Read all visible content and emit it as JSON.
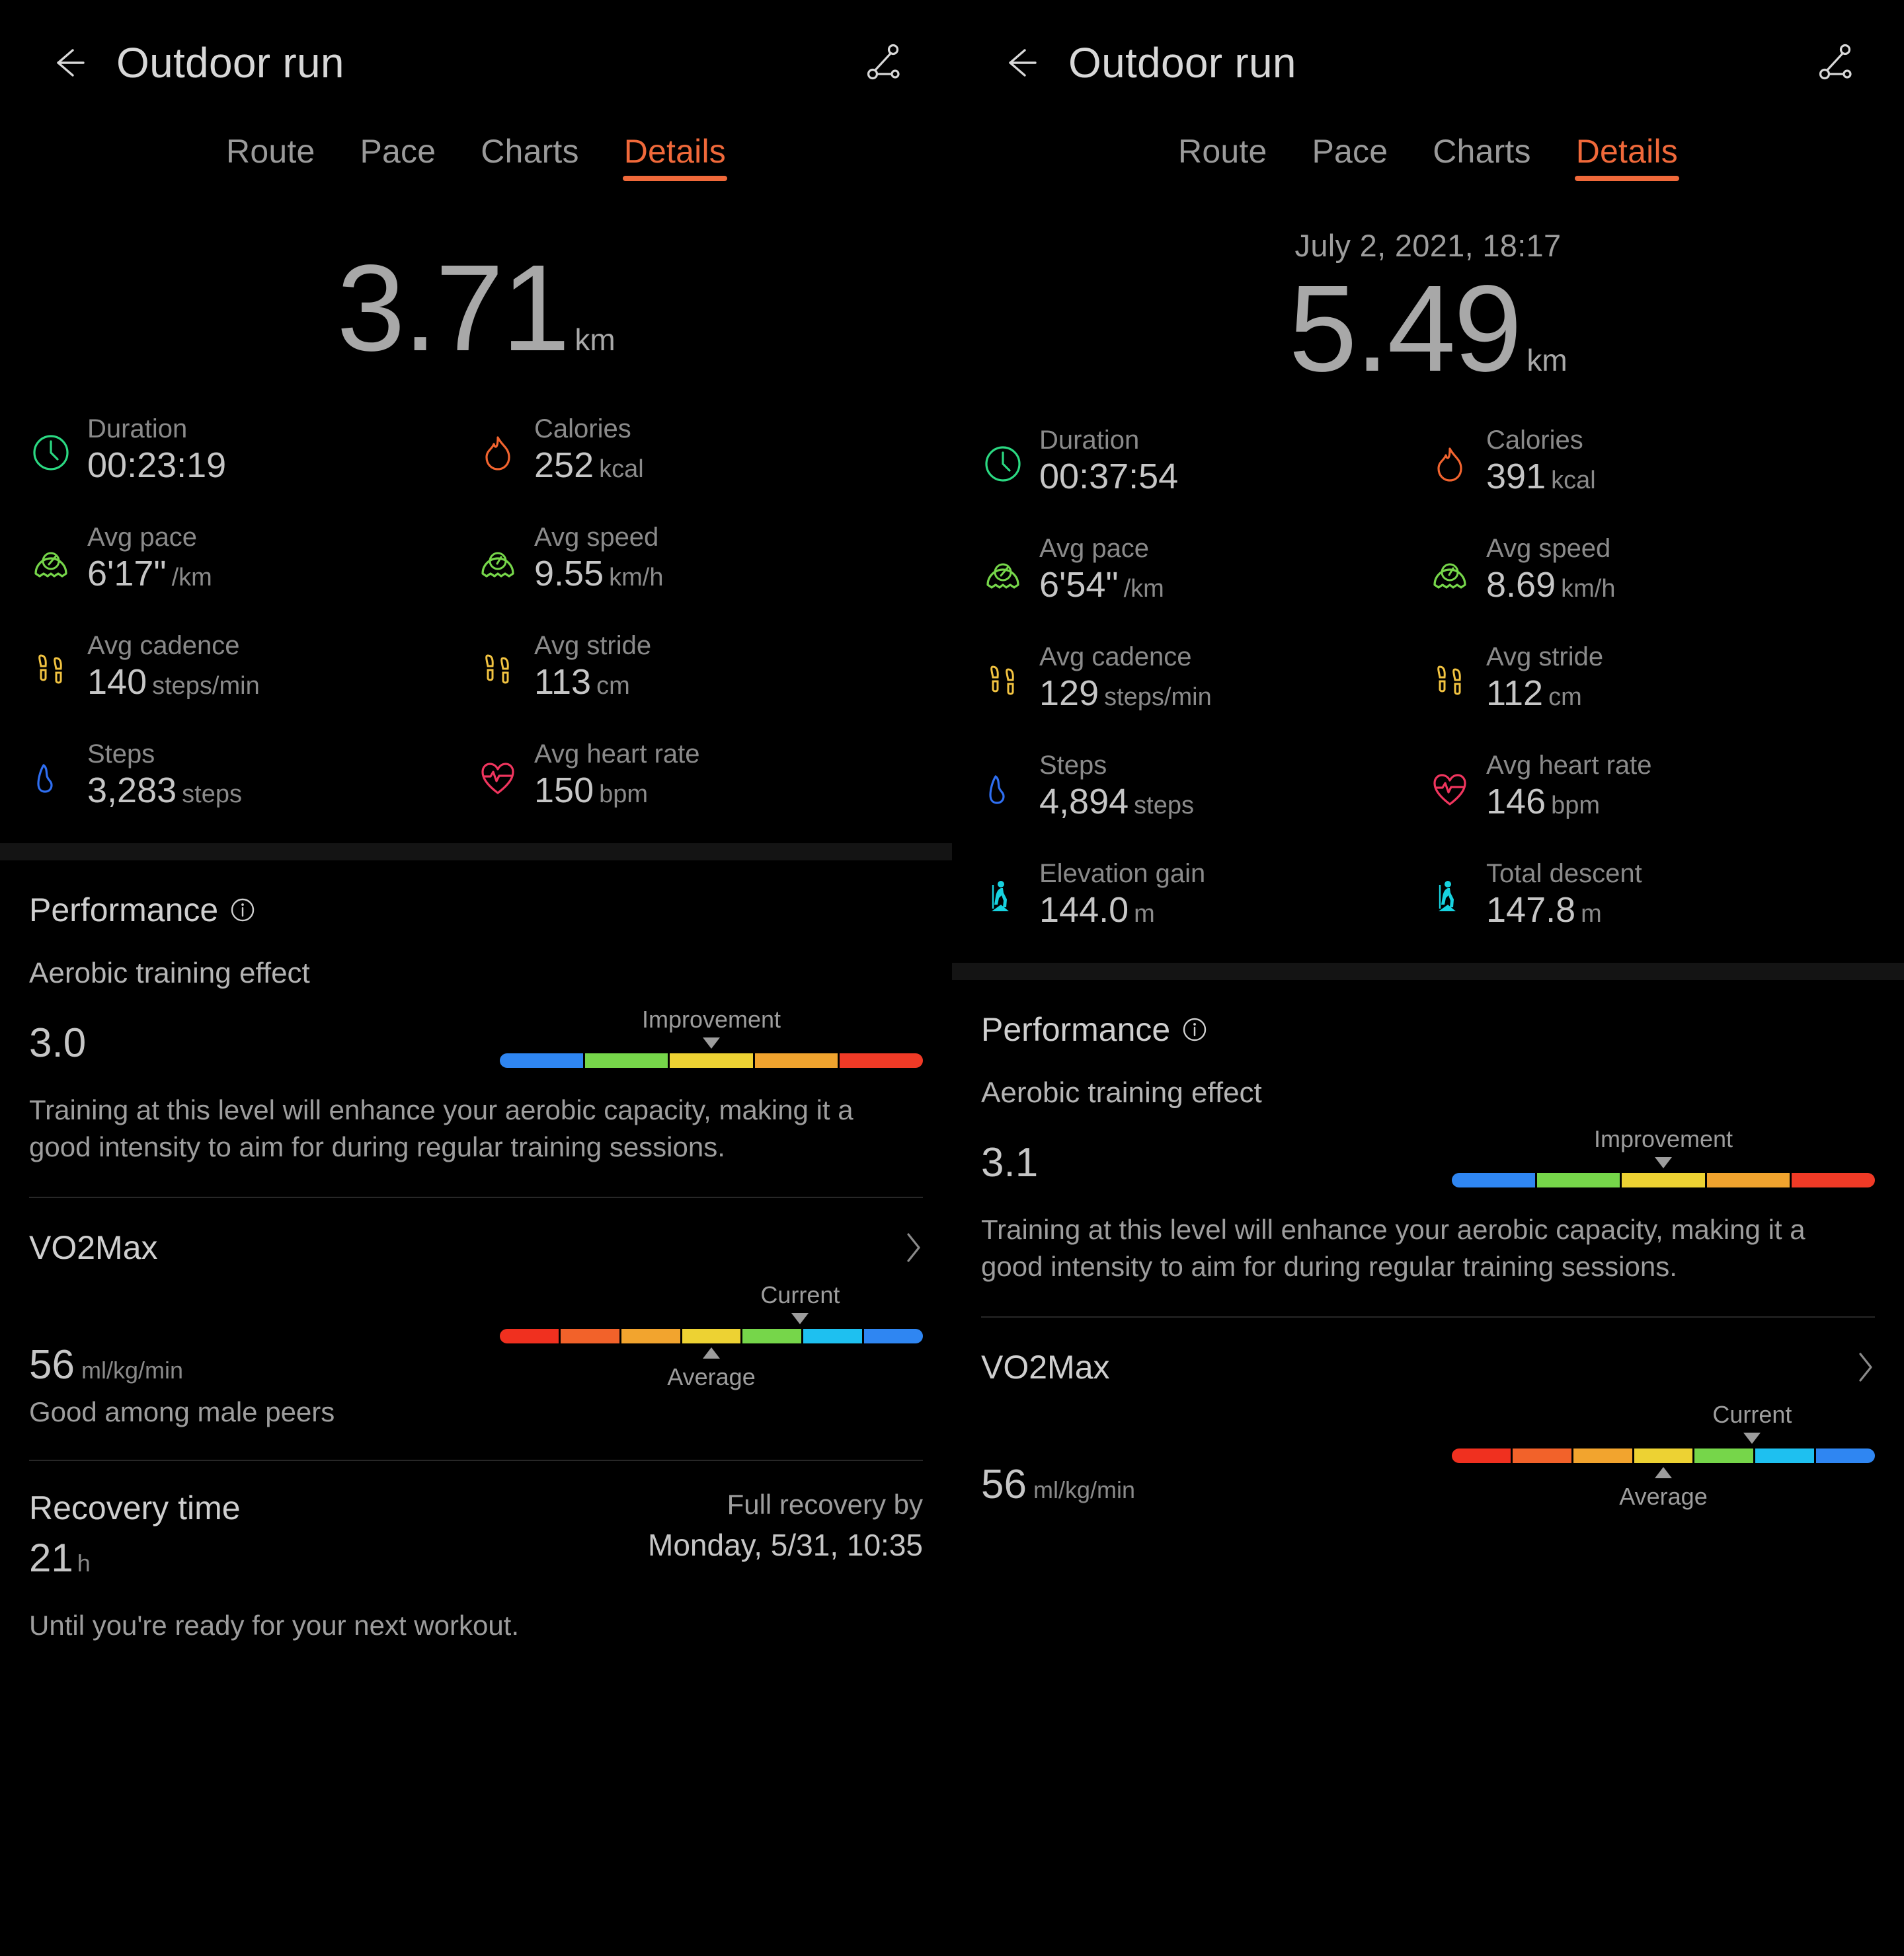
{
  "accent_color": "#f0693a",
  "screens": [
    {
      "appbar": {
        "title": "Outdoor run",
        "back_icon": "arrow-left-icon",
        "share_icon": "share-route-icon"
      },
      "tabs": [
        {
          "label": "Route",
          "active": false
        },
        {
          "label": "Pace",
          "active": false
        },
        {
          "label": "Charts",
          "active": false
        },
        {
          "label": "Details",
          "active": true
        }
      ],
      "session_date": "",
      "hero": {
        "value": "3.71",
        "unit": "km"
      },
      "stats": [
        {
          "icon": "clock-icon",
          "color": "#2bd982",
          "label": "Duration",
          "value": "00:23:19",
          "unit": ""
        },
        {
          "icon": "flame-icon",
          "color": "#f2642f",
          "label": "Calories",
          "value": "252",
          "unit": "kcal"
        },
        {
          "icon": "speedometer-icon",
          "color": "#76d64a",
          "label": "Avg pace",
          "value": "6'17\"",
          "unit": "/km"
        },
        {
          "icon": "speedometer-icon",
          "color": "#76d64a",
          "label": "Avg speed",
          "value": "9.55",
          "unit": "km/h"
        },
        {
          "icon": "footprints-icon",
          "color": "#f2c341",
          "label": "Avg cadence",
          "value": "140",
          "unit": "steps/min"
        },
        {
          "icon": "footprints-icon",
          "color": "#f2c341",
          "label": "Avg stride",
          "value": "113",
          "unit": "cm"
        },
        {
          "icon": "shoe-icon",
          "color": "#2f6ff2",
          "label": "Steps",
          "value": "3,283",
          "unit": "steps"
        },
        {
          "icon": "heart-pulse-icon",
          "color": "#f0355e",
          "label": "Avg heart rate",
          "value": "150",
          "unit": "bpm"
        }
      ],
      "performance": {
        "title": "Performance",
        "info_icon": "info-icon",
        "aerobic": {
          "label": "Aerobic training effect",
          "value": "3.0",
          "marker_label": "Improvement",
          "marker_pos_pct": 50,
          "segments": [
            "#2f86f2",
            "#76d64a",
            "#edd233",
            "#f0a32e",
            "#f03a26"
          ],
          "description": "Training at this level will enhance your aerobic capacity, making it a good intensity to aim for during regular training sessions."
        },
        "vo2max": {
          "label": "VO2Max",
          "value": "56",
          "unit": "ml/kg/min",
          "chevron_icon": "chevron-right-icon",
          "current_label": "Current",
          "current_pos_pct": 71,
          "average_label": "Average",
          "average_pos_pct": 50,
          "segments": [
            "#f0301f",
            "#f2622a",
            "#f2a42e",
            "#edd233",
            "#76d64a",
            "#1ec0f0",
            "#2f86f2"
          ],
          "note": "Good among male peers"
        },
        "recovery": {
          "title": "Recovery time",
          "value": "21",
          "unit": "h",
          "full_recovery_label": "Full recovery by",
          "full_recovery_value": "Monday, 5/31, 10:35",
          "footnote": "Until you're ready for your next workout."
        }
      }
    },
    {
      "appbar": {
        "title": "Outdoor run",
        "back_icon": "arrow-left-icon",
        "share_icon": "share-route-icon"
      },
      "tabs": [
        {
          "label": "Route",
          "active": false
        },
        {
          "label": "Pace",
          "active": false
        },
        {
          "label": "Charts",
          "active": false
        },
        {
          "label": "Details",
          "active": true
        }
      ],
      "session_date": "July 2, 2021, 18:17",
      "hero": {
        "value": "5.49",
        "unit": "km"
      },
      "stats": [
        {
          "icon": "clock-icon",
          "color": "#2bd982",
          "label": "Duration",
          "value": "00:37:54",
          "unit": ""
        },
        {
          "icon": "flame-icon",
          "color": "#f2642f",
          "label": "Calories",
          "value": "391",
          "unit": "kcal"
        },
        {
          "icon": "speedometer-icon",
          "color": "#76d64a",
          "label": "Avg pace",
          "value": "6'54\"",
          "unit": "/km"
        },
        {
          "icon": "speedometer-icon",
          "color": "#76d64a",
          "label": "Avg speed",
          "value": "8.69",
          "unit": "km/h"
        },
        {
          "icon": "footprints-icon",
          "color": "#f2c341",
          "label": "Avg cadence",
          "value": "129",
          "unit": "steps/min"
        },
        {
          "icon": "footprints-icon",
          "color": "#f2c341",
          "label": "Avg stride",
          "value": "112",
          "unit": "cm"
        },
        {
          "icon": "shoe-icon",
          "color": "#2f6ff2",
          "label": "Steps",
          "value": "4,894",
          "unit": "steps"
        },
        {
          "icon": "heart-pulse-icon",
          "color": "#f0355e",
          "label": "Avg heart rate",
          "value": "146",
          "unit": "bpm"
        },
        {
          "icon": "hiker-icon",
          "color": "#17d3e0",
          "label": "Elevation gain",
          "value": "144.0",
          "unit": "m"
        },
        {
          "icon": "hiker-icon",
          "color": "#17d3e0",
          "label": "Total descent",
          "value": "147.8",
          "unit": "m"
        }
      ],
      "performance": {
        "title": "Performance",
        "info_icon": "info-icon",
        "aerobic": {
          "label": "Aerobic training effect",
          "value": "3.1",
          "marker_label": "Improvement",
          "marker_pos_pct": 50,
          "segments": [
            "#2f86f2",
            "#76d64a",
            "#edd233",
            "#f0a32e",
            "#f03a26"
          ],
          "description": "Training at this level will enhance your aerobic capacity, making it a good intensity to aim for during regular training sessions."
        },
        "vo2max": {
          "label": "VO2Max",
          "value": "56",
          "unit": "ml/kg/min",
          "chevron_icon": "chevron-right-icon",
          "current_label": "Current",
          "current_pos_pct": 71,
          "average_label": "Average",
          "average_pos_pct": 50,
          "segments": [
            "#f0301f",
            "#f2622a",
            "#f2a42e",
            "#edd233",
            "#76d64a",
            "#1ec0f0",
            "#2f86f2"
          ],
          "note": ""
        }
      }
    }
  ]
}
